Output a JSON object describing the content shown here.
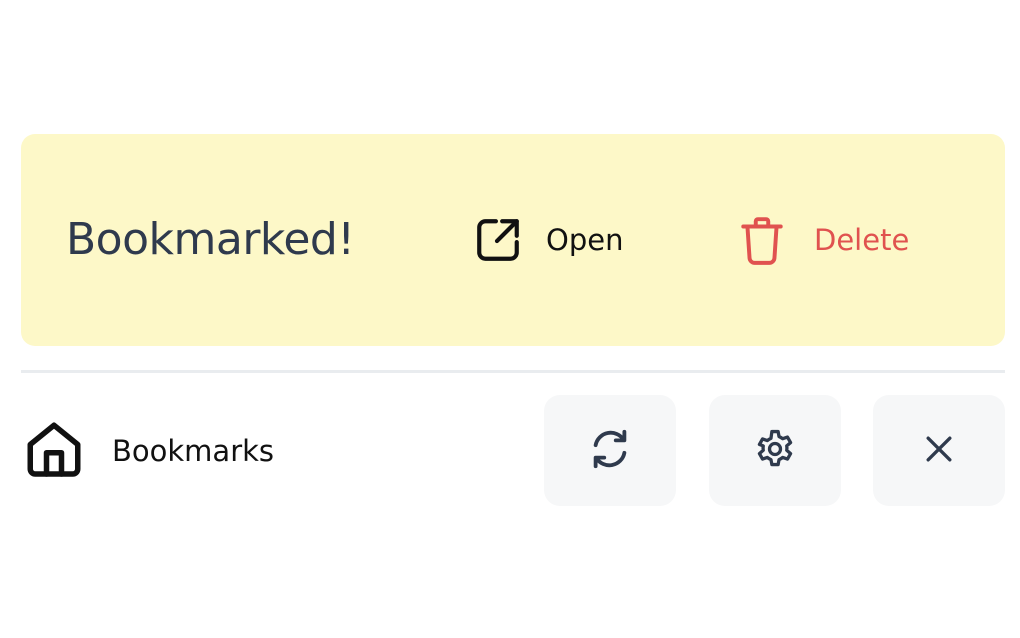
{
  "banner": {
    "message": "Bookmarked!",
    "open_label": "Open",
    "delete_label": "Delete",
    "background_color": "#fdf8c8",
    "delete_color": "#e0524f",
    "open_icon": "external-link-icon",
    "delete_icon": "trash-icon"
  },
  "footer": {
    "home_label": "Bookmarks",
    "home_icon": "home-icon",
    "buttons": [
      {
        "name": "refresh",
        "icon": "refresh-icon"
      },
      {
        "name": "settings",
        "icon": "gear-icon"
      },
      {
        "name": "close",
        "icon": "close-icon"
      }
    ],
    "button_background_color": "#f6f7f8"
  }
}
